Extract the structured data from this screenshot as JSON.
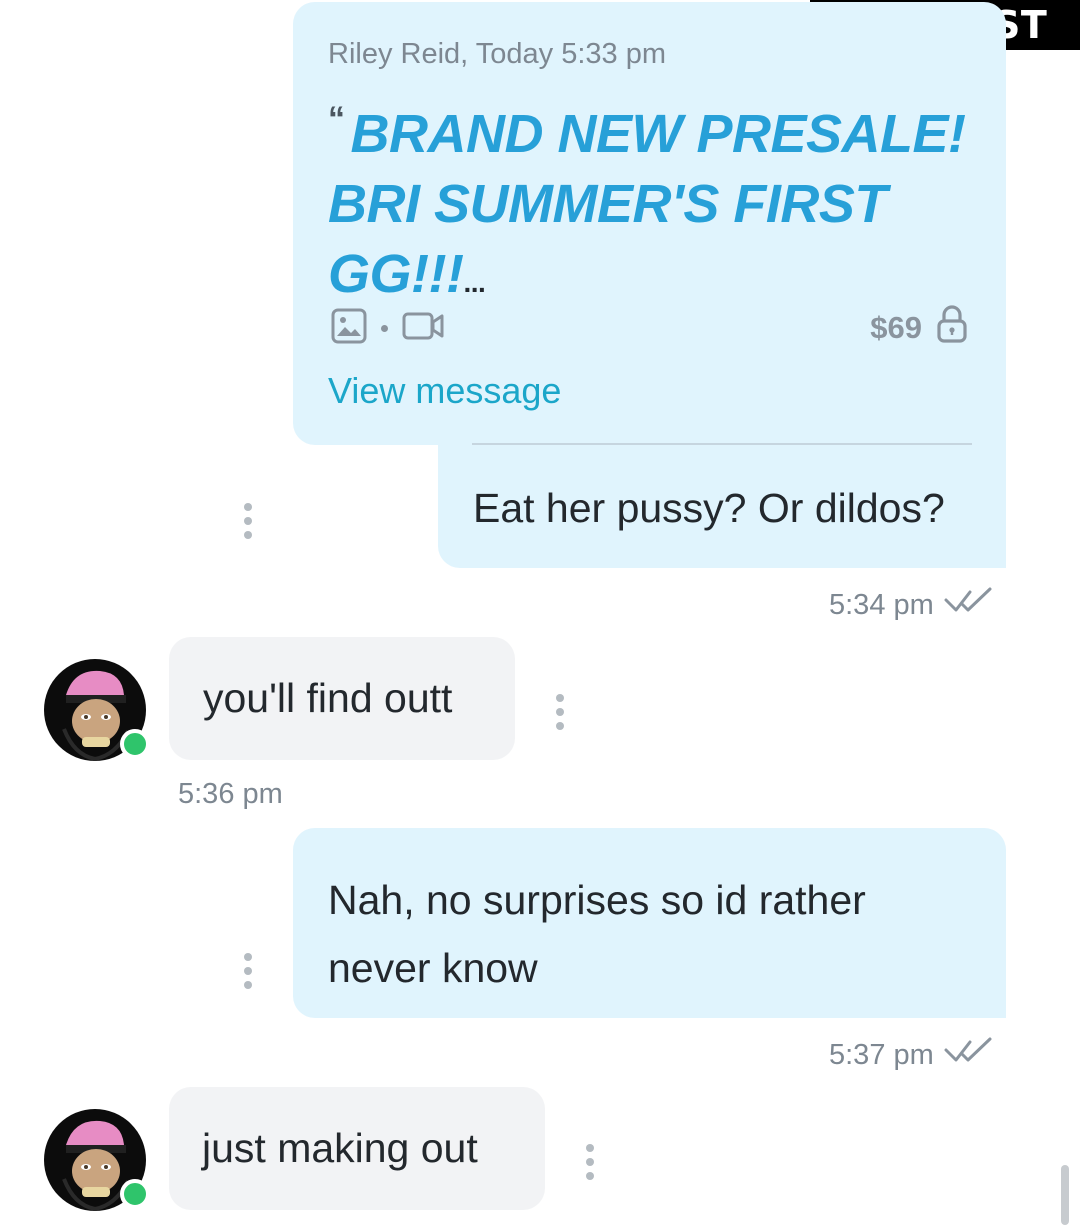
{
  "watermark": "CELEB.ST",
  "quote": {
    "meta": "Riley Reid, Today 5:33 pm",
    "quote_mark": "“",
    "text": "BRAND NEW PRESALE! BRI SUMMER'S FIRST GG!!!",
    "ellipsis": "...",
    "price": "$69",
    "view_link": "View message",
    "icons": [
      "image-icon",
      "video-icon",
      "lock-icon"
    ]
  },
  "messages": [
    {
      "from": "me",
      "text": "Eat her pussy? Or dildos?",
      "time": "5:34 pm"
    },
    {
      "from": "them",
      "text": "you'll find outt",
      "time": "5:36 pm"
    },
    {
      "from": "me",
      "text": "Nah, no surprises so id rather never know",
      "time": "5:37 pm"
    },
    {
      "from": "them",
      "text": "just making out"
    }
  ],
  "colors": {
    "outgoing_bubble": "#e0f4fd",
    "incoming_bubble": "#f2f3f5",
    "accent": "#27a0d8",
    "link": "#1ba6c9",
    "online": "#2fc46b"
  }
}
